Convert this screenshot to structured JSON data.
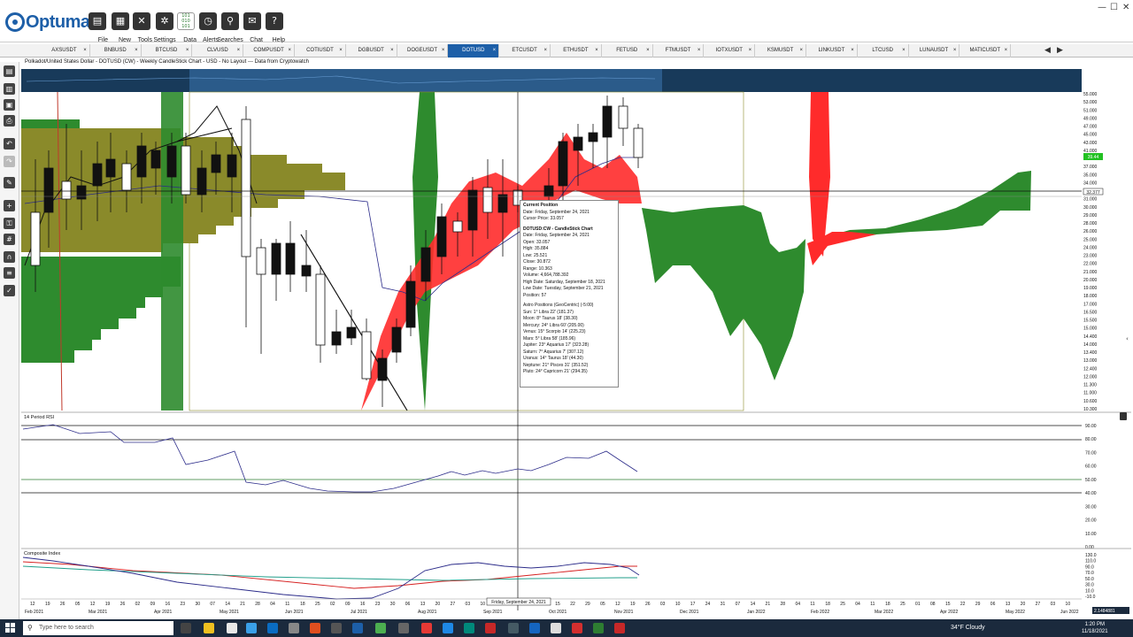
{
  "app": {
    "name": "Optuma"
  },
  "toolbar": {
    "buttons": [
      {
        "label": "File",
        "icon": "folder-icon"
      },
      {
        "label": "New",
        "icon": "document-icon"
      },
      {
        "label": "Tools",
        "icon": "tools-icon"
      },
      {
        "label": "Settings",
        "icon": "gear-icon"
      },
      {
        "label": "Data",
        "icon": "binary-data-icon"
      },
      {
        "label": "Alerts",
        "icon": "alarm-clock-icon"
      },
      {
        "label": "Searches",
        "icon": "search-icon"
      },
      {
        "label": "Chat",
        "icon": "chat-icon"
      },
      {
        "label": "Help",
        "icon": "help-icon"
      }
    ]
  },
  "tabs": [
    "AXSUSDT",
    "BNBUSD",
    "BTCUSD",
    "CLVUSD",
    "COMPUSDT",
    "COTIUSDT",
    "DGBUSDT",
    "DOGEUSDT",
    "DOTUSD",
    "ETCUSDT",
    "ETHUSDT",
    "FETUSD",
    "FTMUSDT",
    "IOTXUSDT",
    "KSMUSDT",
    "LINKUSDT",
    "LTCUSD",
    "LUNAUSDT",
    "MATICUSDT"
  ],
  "active_tab": "DOTUSD",
  "chart_title": "Polkadot/United States Dollar - DOTUSD (CW) - Weekly CandleStick Chart - USD - No Layout --- Data from Cryptowatch",
  "price_scale": [
    "55.000",
    "53.000",
    "51.000",
    "49.000",
    "47.000",
    "45.000",
    "43.000",
    "41.000",
    "39.000",
    "37.000",
    "35.000",
    "34.000",
    "33.000",
    "31.000",
    "30.000",
    "29.000",
    "28.000",
    "26.000",
    "25.000",
    "24.000",
    "23.000",
    "22.000",
    "21.000",
    "20.000",
    "19.000",
    "18.000",
    "17.000",
    "16.500",
    "15.500",
    "15.000",
    "14.400",
    "14.000",
    "13.400",
    "13.000",
    "12.400",
    "12.000",
    "11.300",
    "11.000",
    "10.600",
    "10.300"
  ],
  "price_badges": {
    "last": "39.44",
    "cursor": "32.377"
  },
  "rsi": {
    "title": "14 Period RSI",
    "scale": [
      "90.00",
      "80.00",
      "70.00",
      "60.00",
      "50.00",
      "40.00",
      "30.00",
      "20.00",
      "10.00",
      "0.00"
    ]
  },
  "composite": {
    "title": "Composite Index",
    "scale": [
      "130.0",
      "110.0",
      "90.0",
      "70.0",
      "50.0",
      "30.0",
      "10.0",
      "-10.0"
    ]
  },
  "date_ticks": [
    "12",
    "19",
    "26",
    "05",
    "12",
    "19",
    "26",
    "02",
    "09",
    "16",
    "23",
    "30",
    "07",
    "14",
    "21",
    "28",
    "04",
    "11",
    "18",
    "25",
    "02",
    "09",
    "16",
    "23",
    "30",
    "06",
    "13",
    "20",
    "27",
    "03",
    "10",
    "17",
    "24",
    "01",
    "08",
    "15",
    "22",
    "29",
    "05",
    "12",
    "19",
    "26",
    "03",
    "10",
    "17",
    "24",
    "31",
    "07",
    "14",
    "21",
    "28",
    "04",
    "11",
    "18",
    "25",
    "04",
    "11",
    "18",
    "25",
    "01",
    "08",
    "15",
    "22",
    "29",
    "06",
    "13",
    "20",
    "27",
    "03",
    "10"
  ],
  "month_labels": [
    "Feb 2021",
    "Mar 2021",
    "Apr 2021",
    "May 2021",
    "Jun 2021",
    "Jul 2021",
    "Aug 2021",
    "Sep 2021",
    "Oct 2021",
    "Nov 2021",
    "Dec 2021",
    "Jan 2022",
    "Feb 2022",
    "Mar 2022",
    "Apr 2022",
    "May 2022",
    "Jun 2022"
  ],
  "date_cursor": "Friday, September 24, 2021",
  "axis_corner": "2.1484881",
  "tooltip": {
    "header": "Current Position",
    "date": "Date: Friday, September 24, 2021",
    "cursor_price": "Cursor Price: 33.057",
    "series_title": "DOTUSD:CW - CandleStick Chart",
    "series_date": "Date: Friday, September 24, 2021",
    "open": "Open: 33.057",
    "high": "High: 35.884",
    "low": "Low: 25.521",
    "close": "Close: 30.872",
    "range": "Range: 10.363",
    "volume": "Volume: 4,664,788.392",
    "high_date": "High Date: Saturday, September 18, 2021",
    "low_date": "Low Date: Tuesday, September 21, 2021",
    "position": "Position: 57",
    "astro_title": "Astro Positions (GeoCentric) (-5:00)",
    "sun": "Sun: 1° Libra 22' (181.37)",
    "moon": "Moon: 8° Taurus 18' (38.30)",
    "mercury": "Mercury: 24° Libra 60' (205.00)",
    "venus": "Venus: 15° Scorpio 14' (225.23)",
    "mars": "Mars: 5° Libra 58' (185.96)",
    "jupiter": "Jupiter: 23° Aquarius 17' (323.28)",
    "saturn": "Saturn: 7° Aquarius 7' (307.12)",
    "uranus": "Uranus: 14° Taurus 18' (44.30)",
    "neptune": "Neptune: 21° Pisces 31' (351.52)",
    "pluto": "Pluto: 24° Capricorn 21' (294.35)"
  },
  "taskbar": {
    "search_placeholder": "Type here to search",
    "weather": "34°F  Cloudy",
    "time": "1:20 PM",
    "date": "11/18/2021"
  },
  "colors": {
    "accent": "#1d5fa8",
    "cloud_red": "#ff2b2b",
    "cloud_green": "#2e8b2e",
    "volume_profile": "#8a8a2a"
  },
  "chart_data": {
    "type": "candlestick",
    "symbol": "DOTUSD",
    "timeframe": "Weekly",
    "candles": [
      {
        "t": "2021-09-24",
        "o": 33.057,
        "h": 35.884,
        "l": 25.521,
        "c": 30.872
      }
    ],
    "ylim": [
      10.3,
      55.0
    ],
    "rsi_ylim": [
      0,
      90
    ],
    "composite_ylim": [
      -10,
      130
    ],
    "x_range": [
      "Feb 2021",
      "Jun 2022"
    ]
  }
}
